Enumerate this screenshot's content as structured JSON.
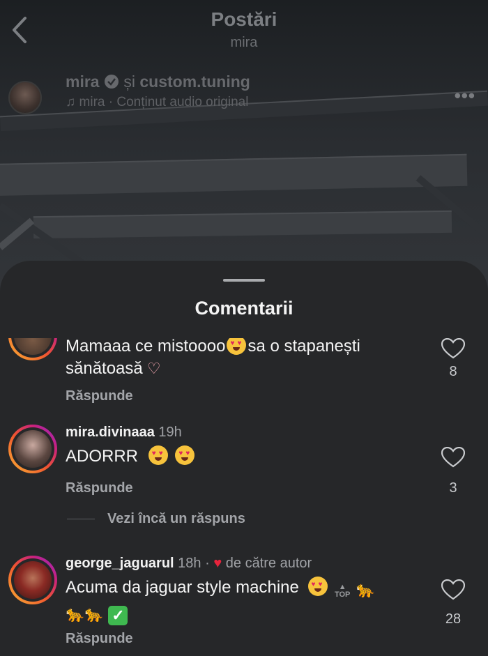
{
  "topbar": {
    "title": "Postări",
    "subtitle": "mira"
  },
  "post": {
    "author": "mira",
    "collab_connector": "și",
    "collaborator": "custom.tuning",
    "audio": "mira · Conținut audio original"
  },
  "sheet": {
    "title": "Comentarii"
  },
  "comments": [
    {
      "text_line1": "Mamaaa ce mistoooo",
      "text_line1_after": "sa o stapanești",
      "text_line2": "sănătoasă",
      "reply": "Răspunde",
      "likes": "8"
    },
    {
      "username": "mira.divinaaa",
      "time": "19h",
      "text": "ADORRR",
      "reply": "Răspunde",
      "likes": "3",
      "more_replies": "Vezi încă un răspuns"
    },
    {
      "username": "george_jaguarul",
      "time": "18h",
      "liked_by_author": "de către autor",
      "text": "Acuma da jaguar style machine",
      "reply": "Răspunde",
      "likes": "28"
    }
  ],
  "colors": {
    "sheet_bg": "#262729",
    "story_ring": "#f0562f",
    "author_heart": "#e8243c"
  },
  "icons": [
    "back-arrow-icon",
    "verified-badge-icon",
    "music-note-icon",
    "more-options-icon",
    "heart-outline-icon",
    "heart-eyes-emoji",
    "top-arrow-emoji",
    "cheetah-emoji",
    "check-mark-emoji",
    "heart-hands-emoji"
  ]
}
